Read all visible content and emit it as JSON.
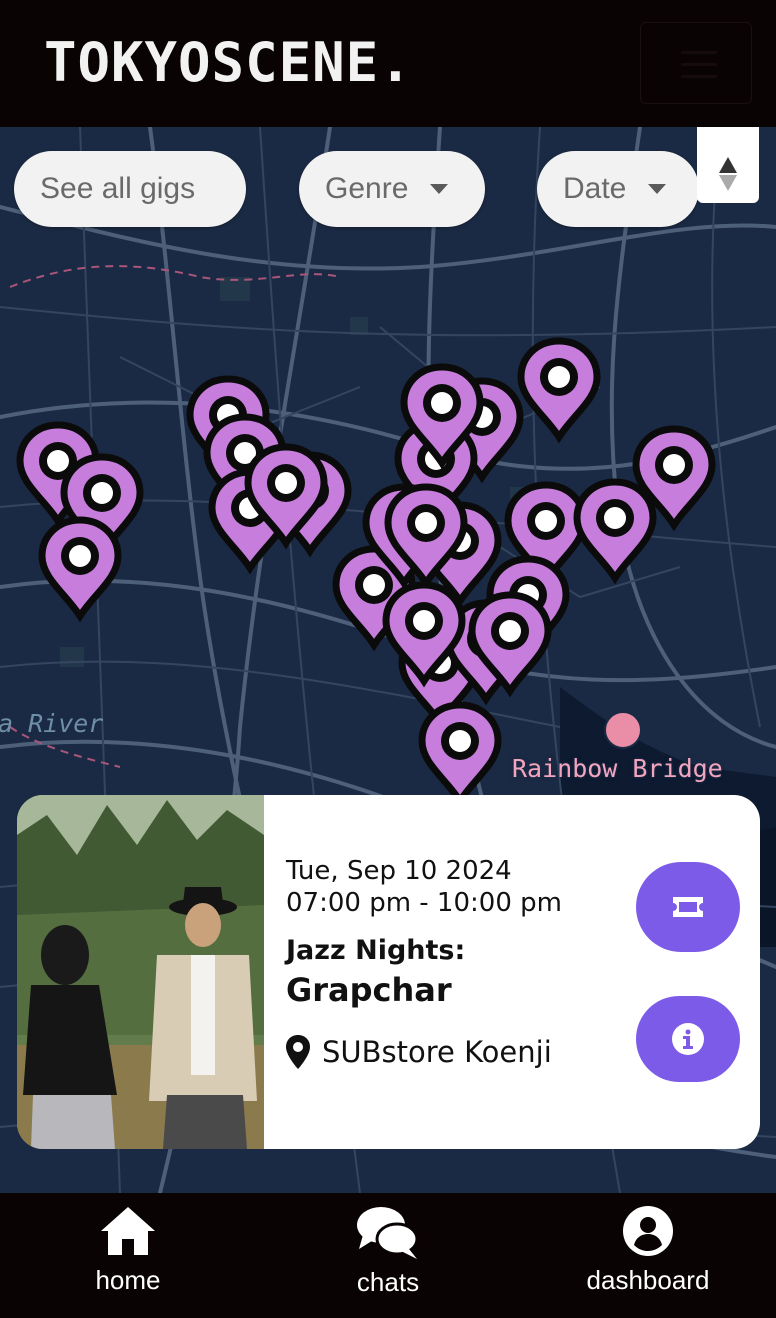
{
  "header": {
    "logo": "TOKYOSCENE."
  },
  "filters": {
    "all_label": "See all gigs",
    "genre_label": "Genre",
    "date_label": "Date"
  },
  "map": {
    "labels": {
      "river": "a River",
      "bridge": "Rainbow Bridge"
    },
    "pin_color": "#c77ddb",
    "background_color": "#1b2a44"
  },
  "event": {
    "date": "Tue, Sep 10 2024",
    "time": "07:00 pm - 10:00 pm",
    "series": "Jazz Nights:",
    "artist": "Grapchar",
    "venue": "SUBstore Koenji",
    "accent_color": "#7b5be8"
  },
  "nav": {
    "home": "home",
    "chats": "chats",
    "dashboard": "dashboard"
  }
}
